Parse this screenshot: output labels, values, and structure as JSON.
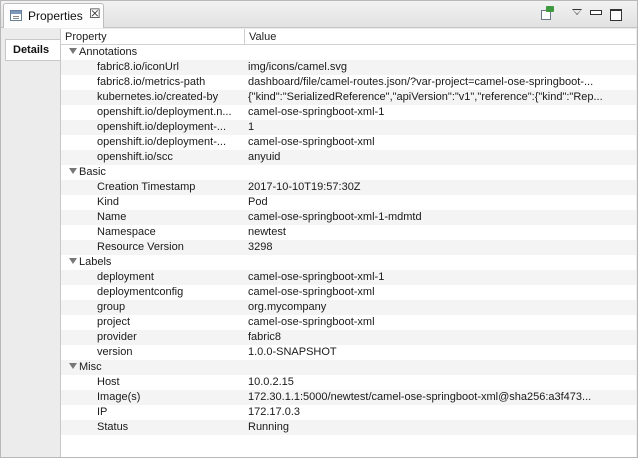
{
  "view": {
    "tab_title": "Properties",
    "tab_icon": "properties-view-icon",
    "toolbar": [
      "pin-to-selection-icon",
      "view-menu-icon",
      "minimize-icon",
      "maximize-icon"
    ]
  },
  "side_tabs": [
    {
      "label": "Details",
      "selected": true
    }
  ],
  "table": {
    "columns": [
      "Property",
      "Value"
    ],
    "groups": [
      {
        "name": "Annotations",
        "expanded": true,
        "rows": [
          {
            "property": "fabric8.io/iconUrl",
            "value": "img/icons/camel.svg"
          },
          {
            "property": "fabric8.io/metrics-path",
            "value": "dashboard/file/camel-routes.json/?var-project=camel-ose-springboot-..."
          },
          {
            "property": "kubernetes.io/created-by",
            "value": "{\"kind\":\"SerializedReference\",\"apiVersion\":\"v1\",\"reference\":{\"kind\":\"Rep..."
          },
          {
            "property": "openshift.io/deployment.n...",
            "value": "camel-ose-springboot-xml-1"
          },
          {
            "property": "openshift.io/deployment-...",
            "value": "1"
          },
          {
            "property": "openshift.io/deployment-...",
            "value": "camel-ose-springboot-xml"
          },
          {
            "property": "openshift.io/scc",
            "value": "anyuid"
          }
        ]
      },
      {
        "name": "Basic",
        "expanded": true,
        "rows": [
          {
            "property": "Creation Timestamp",
            "value": "2017-10-10T19:57:30Z"
          },
          {
            "property": "Kind",
            "value": "Pod"
          },
          {
            "property": "Name",
            "value": "camel-ose-springboot-xml-1-mdmtd"
          },
          {
            "property": "Namespace",
            "value": "newtest"
          },
          {
            "property": "Resource Version",
            "value": "3298"
          }
        ]
      },
      {
        "name": "Labels",
        "expanded": true,
        "rows": [
          {
            "property": "deployment",
            "value": "camel-ose-springboot-xml-1"
          },
          {
            "property": "deploymentconfig",
            "value": "camel-ose-springboot-xml"
          },
          {
            "property": "group",
            "value": "org.mycompany"
          },
          {
            "property": "project",
            "value": "camel-ose-springboot-xml"
          },
          {
            "property": "provider",
            "value": "fabric8"
          },
          {
            "property": "version",
            "value": "1.0.0-SNAPSHOT"
          }
        ]
      },
      {
        "name": "Misc",
        "expanded": true,
        "rows": [
          {
            "property": "Host",
            "value": "10.0.2.15"
          },
          {
            "property": "Image(s)",
            "value": "172.30.1.1:5000/newtest/camel-ose-springboot-xml@sha256:a3f473..."
          },
          {
            "property": "IP",
            "value": "172.17.0.3"
          },
          {
            "property": "Status",
            "value": "Running"
          }
        ]
      }
    ]
  }
}
